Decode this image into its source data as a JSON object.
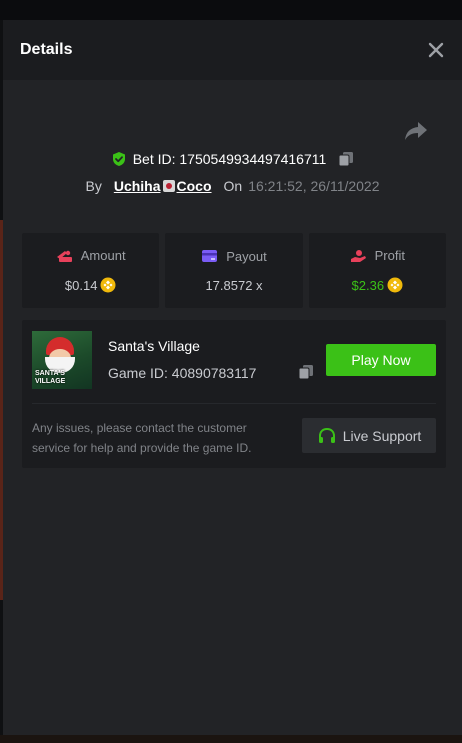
{
  "modal": {
    "title": "Details"
  },
  "bet": {
    "id_label": "Bet ID: 1750549934497416711",
    "by_label": "By",
    "user_prefix": "Uchiha",
    "user_suffix": "Coco",
    "on_label": "On",
    "timestamp": "16:21:52, 26/11/2022"
  },
  "stats": {
    "amount": {
      "label": "Amount",
      "value": "$0.14"
    },
    "payout": {
      "label": "Payout",
      "value": "17.8572 x"
    },
    "profit": {
      "label": "Profit",
      "value": "$2.36"
    }
  },
  "game": {
    "name": "Santa's Village",
    "id_label": "Game ID: 40890783117",
    "thumb_text": "SANTA'S VILLAGE",
    "play_label": "Play Now",
    "issue_text": "Any issues, please contact the customer service for help and provide the game ID.",
    "support_label": "Live Support"
  },
  "colors": {
    "accent_green": "#3bc117",
    "panel": "#222326",
    "card": "#1b1c1f",
    "amount_icon": "#e8415b",
    "payout_icon": "#7a5cf5",
    "profit_icon": "#e8415b"
  },
  "icons": {
    "close": "close-icon",
    "share": "share-icon",
    "shield": "shield-check-icon",
    "copy": "copy-icon",
    "amount": "wallet-coins-icon",
    "payout": "card-icon",
    "profit": "hand-coin-icon",
    "coin": "bnb-coin-icon",
    "headset": "headset-icon"
  }
}
